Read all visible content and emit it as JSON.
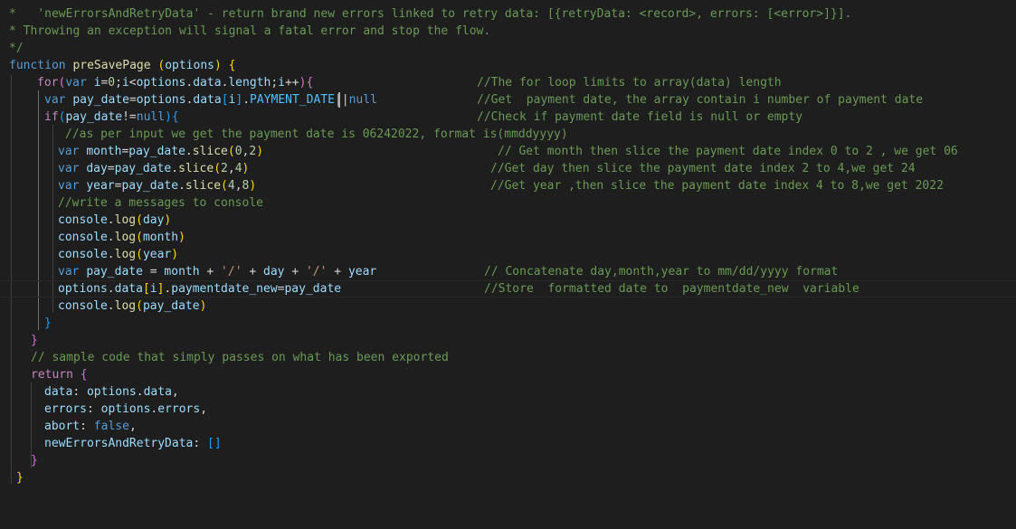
{
  "lines": {
    "l0": {
      "star": "*",
      "a": "'newErrorsAndRetryData' - return brand new errors linked to retry data: [{retryData: <record>, errors: [<error>]}]."
    },
    "l1": {
      "t": "* Throwing an exception will signal a fatal error and stop the flow."
    },
    "l2": {
      "t": "*/"
    },
    "l3": {
      "kw": "function",
      "name": "preSavePage",
      "po": "(",
      "param": "options",
      "pc": ")",
      "bo": "{"
    },
    "l4": {
      "kw": "for",
      "po": "(",
      "var": "var",
      "i": "i",
      "eq": "=",
      "zero": "0",
      "semi1": ";",
      "i2": "i",
      "lt": "<",
      "opts": "options",
      "dot1": ".",
      "data": "data",
      "dot2": ".",
      "len": "length",
      "semi2": ";",
      "i3": "i",
      "pp": "++",
      "pc": ")",
      "bo": "{",
      "comment": "//The for loop limits to array(data) length"
    },
    "l5": {
      "var": "var",
      "pd": "pay_date",
      "eq": "=",
      "opts": "options",
      "dot1": ".",
      "data": "data",
      "bo": "[",
      "i": "i",
      "bc": "]",
      "dot2": ".",
      "pdc": "PAYMENT_DATE",
      "or": "||",
      "null": "null",
      "comment": "//Get  payment date, the array contain i number of payment date"
    },
    "l6": {
      "kw": "if",
      "po": "(",
      "pd": "pay_date",
      "ne": "!=",
      "null": "null",
      "pc": ")",
      "bo": "{",
      "comment": "//Check if payment date field is null or empty"
    },
    "l7": {
      "t": "//as per input we get the payment date is 06242022, format is(mmddyyyy)"
    },
    "l8": {
      "var": "var",
      "name": "month",
      "eq": "=",
      "pd": "pay_date",
      "dot": ".",
      "fn": "slice",
      "po": "(",
      "a": "0",
      "comma": ",",
      "b": "2",
      "pc": ")",
      "comment": "// Get month then slice the payment date index 0 to 2 , we get 06"
    },
    "l9": {
      "var": "var",
      "name": "day",
      "eq": "=",
      "pd": "pay_date",
      "dot": ".",
      "fn": "slice",
      "po": "(",
      "a": "2",
      "comma": ",",
      "b": "4",
      "pc": ")",
      "comment": "//Get day then slice the payment date index 2 to 4,we get 24"
    },
    "l10": {
      "var": "var",
      "name": "year",
      "eq": "=",
      "pd": "pay_date",
      "dot": ".",
      "fn": "slice",
      "po": "(",
      "a": "4",
      "comma": ",",
      "b": "8",
      "pc": ")",
      "comment": "//Get year ,then slice the payment date index 4 to 8,we get 2022"
    },
    "l11": {
      "t": "//write a messages to console"
    },
    "l12": {
      "obj": "console",
      "dot": ".",
      "fn": "log",
      "po": "(",
      "arg": "day",
      "pc": ")"
    },
    "l13": {
      "obj": "console",
      "dot": ".",
      "fn": "log",
      "po": "(",
      "arg": "month",
      "pc": ")"
    },
    "l14": {
      "obj": "console",
      "dot": ".",
      "fn": "log",
      "po": "(",
      "arg": "year",
      "pc": ")"
    },
    "l15": {
      "var": "var",
      "pd": "pay_date",
      "eq": " = ",
      "month": "month",
      "plus1": " + ",
      "s1": "'/'",
      "plus2": " + ",
      "day": "day",
      "plus3": " + ",
      "s2": "'/'",
      "plus4": " + ",
      "year": "year",
      "comment": "// Concatenate day,month,year to mm/dd/yyyy format"
    },
    "l16": {
      "opts": "options",
      "dot1": ".",
      "data": "data",
      "bo": "[",
      "i": "i",
      "bc": "]",
      "dot2": ".",
      "pdn": "paymentdate_new",
      "eq": "=",
      "pd": "pay_date",
      "comment": "//Store  formatted date to  paymentdate_new  variable"
    },
    "l17": {
      "obj": "console",
      "dot": ".",
      "fn": "log",
      "po": "(",
      "arg": "pay_date",
      "pc": ")"
    },
    "l18": {
      "b": "}"
    },
    "l19": {
      "b": "}"
    },
    "l20": {
      "t": "// sample code that simply passes on what has been exported"
    },
    "l21": {
      "kw": "return",
      "bo": "{"
    },
    "l22": {
      "key": "data",
      "colon": ": ",
      "opts": "options",
      "dot": ".",
      "val": "data",
      "comma": ","
    },
    "l23": {
      "key": "errors",
      "colon": ": ",
      "opts": "options",
      "dot": ".",
      "val": "errors",
      "comma": ","
    },
    "l24": {
      "key": "abort",
      "colon": ": ",
      "val": "false",
      "comma": ","
    },
    "l25": {
      "key": "newErrorsAndRetryData",
      "colon": ": ",
      "arr": "[]"
    },
    "l26": {
      "b": "}"
    },
    "l27": {
      "b": "}"
    }
  }
}
